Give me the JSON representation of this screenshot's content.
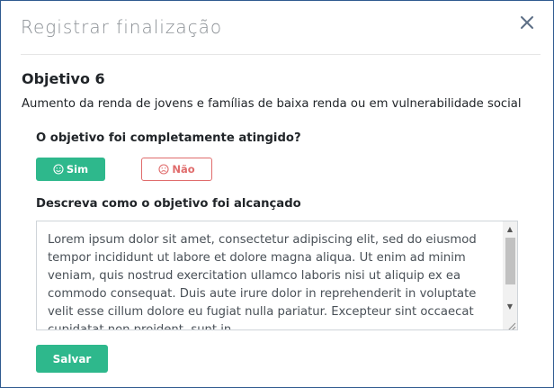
{
  "dialog": {
    "title": "Registrar finalização",
    "close_icon": "close-icon"
  },
  "objective": {
    "title": "Objetivo 6",
    "description": "Aumento da renda de jovens e famílias de baixa renda ou em vulnerabilidade social"
  },
  "question": {
    "label": "O objetivo foi completamente atingido?",
    "yes_label": "Sim",
    "yes_icon": "smile-icon",
    "no_label": "Não",
    "no_icon": "frown-icon",
    "selected": "Sim"
  },
  "description_field": {
    "label": "Descreva como o objetivo foi alcançado",
    "value": "Lorem ipsum dolor sit amet, consectetur adipiscing elit, sed do eiusmod tempor incididunt ut labore et dolore magna aliqua. Ut enim ad minim veniam, quis nostrud exercitation ullamco laboris nisi ut aliquip ex ea commodo consequat. Duis aute irure dolor in reprehenderit in voluptate velit esse cillum dolore eu fugiat nulla pariatur. Excepteur sint occaecat cupidatat non proident, sunt in"
  },
  "actions": {
    "save_label": "Salvar"
  },
  "colors": {
    "primary": "#2eb88c",
    "danger": "#e06c6c",
    "border": "#2f5b8f"
  }
}
